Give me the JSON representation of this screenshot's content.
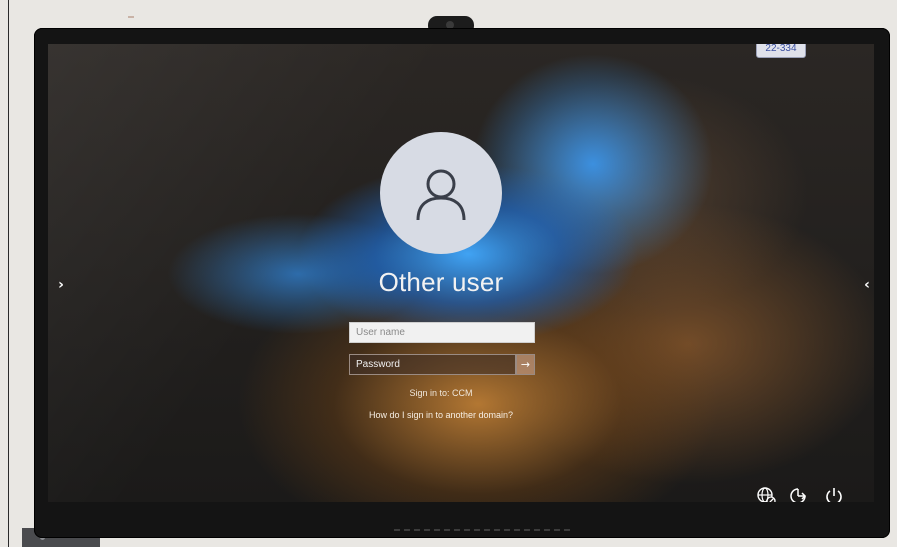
{
  "sticker": {
    "text": "22-334"
  },
  "login": {
    "user_display_name": "Other user",
    "username_placeholder": "User name",
    "password_placeholder": "Password",
    "submit_symbol": "→",
    "sign_in_to": "Sign in to: CCM",
    "domain_help_link": "How do I sign in to another domain?"
  },
  "nav": {
    "left_symbol": "›",
    "right_symbol": "‹"
  },
  "icons": {
    "avatar": "user-silhouette-icon",
    "network": "network-globe-icon",
    "accessibility": "accessibility-icon",
    "power": "power-icon"
  },
  "colors": {
    "avatar_bg": "#d7dbe4",
    "text": "#f2f2f2",
    "accent_blue": "#42aaff",
    "accent_orange": "#cd8737"
  }
}
